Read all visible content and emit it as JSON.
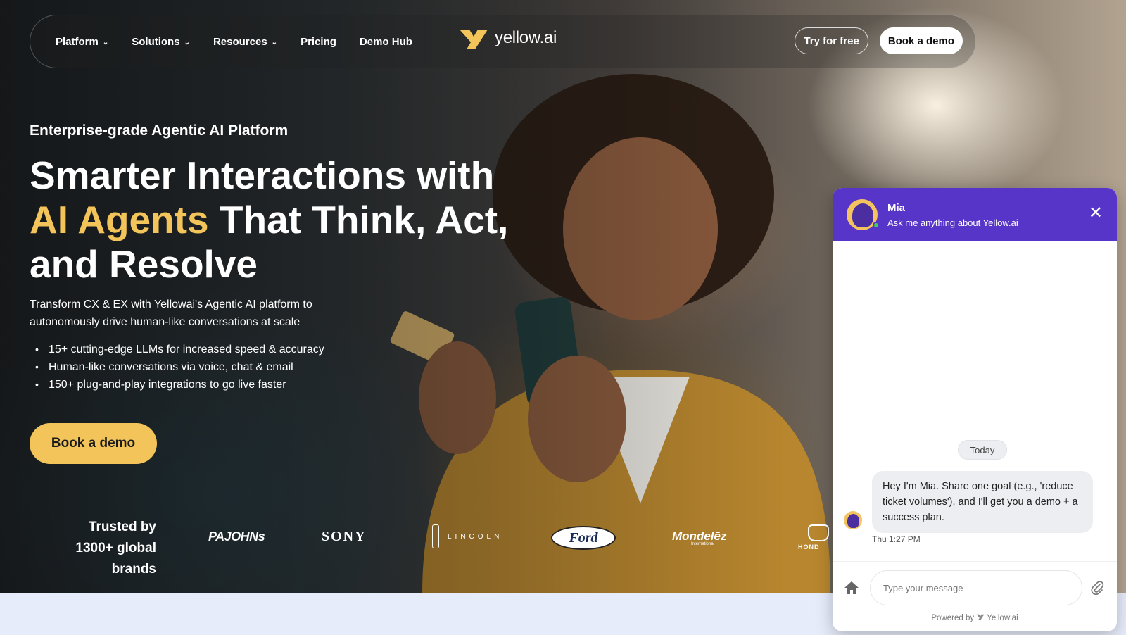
{
  "nav": {
    "items": [
      {
        "label": "Platform",
        "dropdown": true
      },
      {
        "label": "Solutions",
        "dropdown": true
      },
      {
        "label": "Resources",
        "dropdown": true
      },
      {
        "label": "Pricing",
        "dropdown": false
      },
      {
        "label": "Demo Hub",
        "dropdown": false
      }
    ],
    "logo_text": "yellow.ai",
    "try_label": "Try for free",
    "demo_label": "Book a demo"
  },
  "hero": {
    "eyebrow": "Enterprise-grade Agentic AI Platform",
    "headline_line1": "Smarter Interactions with",
    "headline_accent": "AI Agents",
    "headline_line2_rest": " That Think, Act,",
    "headline_line3": "and Resolve",
    "description": "Transform CX & EX with Yellowai's Agentic AI platform to autonomously drive human-like conversations at scale",
    "bullets": [
      "15+ cutting-edge LLMs for increased speed & accuracy",
      "Human-like conversations via voice, chat & email",
      "150+ plug-and-play integrations to go live faster"
    ],
    "cta_label": "Book a demo",
    "accent_color": "#f2c45a"
  },
  "trust": {
    "line1": "Trusted by",
    "line2": "1300+ global brands",
    "brands": {
      "papajohns": "PAJOHNs",
      "sony": "SONY",
      "lincoln": "LINCOLN",
      "ford": "Ford",
      "mondelez": "Mondelēz",
      "mondelez_sub": "International",
      "honda": "HOND"
    }
  },
  "chat": {
    "name": "Mia",
    "subtitle": "Ask me anything about Yellow.ai",
    "day": "Today",
    "message": "Hey  I'm Mia. Share one goal (e.g., 'reduce ticket volumes'), and I'll get you a demo + a success plan.",
    "time": "Thu 1:27 PM",
    "input_placeholder": "Type your message",
    "powered_prefix": "Powered by",
    "powered_brand": "Yellow.ai",
    "header_color": "#5735c9",
    "icons": [
      "close-icon",
      "home-icon",
      "attachment-icon"
    ]
  }
}
